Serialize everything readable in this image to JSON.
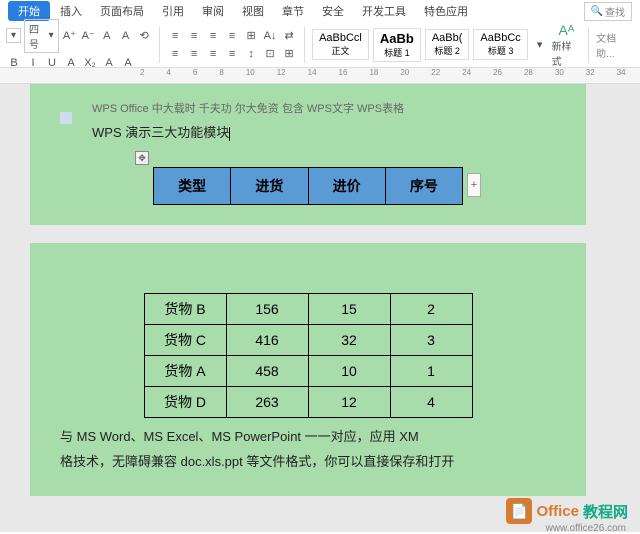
{
  "tabs": {
    "active": "开始",
    "items": [
      "插入",
      "页面布局",
      "引用",
      "审阅",
      "视图",
      "章节",
      "安全",
      "开发工具",
      "特色应用"
    ]
  },
  "search": {
    "placeholder": "查找"
  },
  "toolbar": {
    "fontsize": "四号",
    "btns_top": [
      "A⁺",
      "A⁻",
      "A",
      "A",
      "⟲"
    ],
    "btns_bot": [
      "B",
      "I",
      "U",
      "A",
      "X₂",
      "A",
      "A"
    ],
    "para_top": [
      "≡",
      "≡",
      "≡",
      "≡",
      "⊞",
      "A↓",
      "⇄"
    ],
    "para_bot": [
      "≡",
      "≡",
      "≡",
      "≡",
      "↕",
      "⊡",
      "⊞"
    ],
    "styles": [
      {
        "p": "AaBbCcl",
        "n": "正文"
      },
      {
        "p": "AaBb",
        "n": "标题 1",
        "b": true
      },
      {
        "p": "AaBb(",
        "n": "标题 2"
      },
      {
        "p": "AaBbCc",
        "n": "标题 3"
      }
    ],
    "new_style": "新样式",
    "doc_assist": "文档助..."
  },
  "ruler": [
    "2",
    "4",
    "6",
    "8",
    "10",
    "12",
    "14",
    "16",
    "18",
    "20",
    "22",
    "24",
    "26",
    "28",
    "30",
    "32",
    "34"
  ],
  "doc": {
    "truncated_top": "WPS Office 中大载时 千夫功 尔大免资 包含 WPS文字 WPS表格",
    "title": "WPS 演示三大功能模块",
    "header": [
      "类型",
      "进货",
      "进价",
      "序号"
    ],
    "add_col": "+",
    "data": [
      [
        "货物 B",
        "156",
        "15",
        "2"
      ],
      [
        "货物 C",
        "416",
        "32",
        "3"
      ],
      [
        "货物 A",
        "458",
        "10",
        "1"
      ],
      [
        "货物 D",
        "263",
        "12",
        "4"
      ]
    ],
    "footer1": "与 MS Word、MS Excel、MS PowerPoint 一一对应，应用 XM",
    "footer2": "格技术，无障碍兼容 doc.xls.ppt 等文件格式，你可以直接保存和打开"
  },
  "watermark": {
    "t1": "Office",
    "t2": "教程网",
    "url": "www.office26.com"
  }
}
